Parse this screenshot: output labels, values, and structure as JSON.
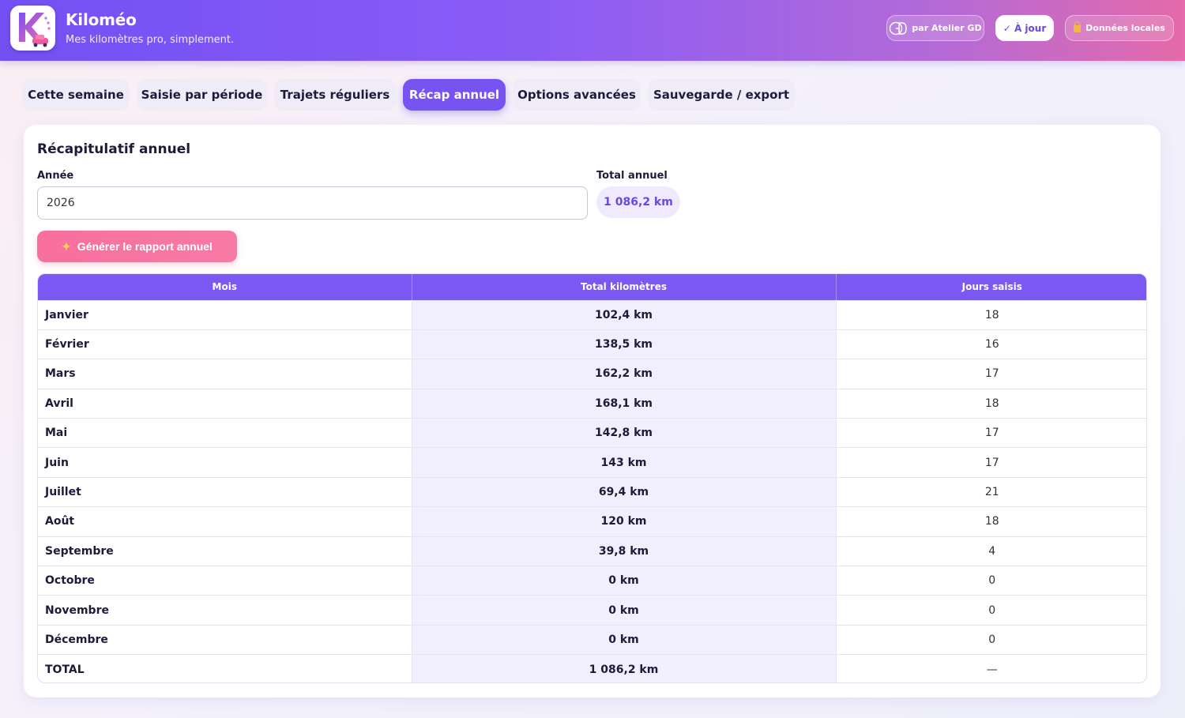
{
  "app": {
    "title": "Kiloméo",
    "subtitle": "Mes kilomètres pro, simplement."
  },
  "header": {
    "badges": {
      "atelier": "par Atelier GD",
      "status": "✓ À jour",
      "local": "Données locales"
    }
  },
  "tabs": [
    {
      "label": "Cette semaine",
      "active": false
    },
    {
      "label": "Saisie par période",
      "active": false
    },
    {
      "label": "Trajets réguliers",
      "active": false
    },
    {
      "label": "Récap annuel",
      "active": true
    },
    {
      "label": "Options avancées",
      "active": false
    },
    {
      "label": "Sauvegarde / export",
      "active": false
    }
  ],
  "recap": {
    "title": "Récapitulatif annuel",
    "year_label": "Année",
    "year_value": "2026",
    "total_label": "Total annuel",
    "total_value": "1 086,2 km",
    "generate_label": "Générer le rapport annuel",
    "table": {
      "headers": [
        "Mois",
        "Total kilomètres",
        "Jours saisis"
      ],
      "rows": [
        {
          "month": "Janvier",
          "km": "102,4 km",
          "days": "18"
        },
        {
          "month": "Février",
          "km": "138,5 km",
          "days": "16"
        },
        {
          "month": "Mars",
          "km": "162,2 km",
          "days": "17"
        },
        {
          "month": "Avril",
          "km": "168,1 km",
          "days": "18"
        },
        {
          "month": "Mai",
          "km": "142,8 km",
          "days": "17"
        },
        {
          "month": "Juin",
          "km": "143 km",
          "days": "17"
        },
        {
          "month": "Juillet",
          "km": "69,4 km",
          "days": "21"
        },
        {
          "month": "Août",
          "km": "120 km",
          "days": "18"
        },
        {
          "month": "Septembre",
          "km": "39,8 km",
          "days": "4"
        },
        {
          "month": "Octobre",
          "km": "0 km",
          "days": "0"
        },
        {
          "month": "Novembre",
          "km": "0 km",
          "days": "0"
        },
        {
          "month": "Décembre",
          "km": "0 km",
          "days": "0"
        },
        {
          "month": "TOTAL",
          "km": "1 086,2 km",
          "days": "—"
        }
      ]
    }
  },
  "colors": {
    "accent": "#7753f1",
    "header_start": "#7350f3",
    "header_end": "#e46aa9",
    "button_pink": "#f76f9e"
  },
  "icons": {
    "logo": "kilomeo-logo-icon",
    "atelier": "atelier-gd-logo-icon",
    "lock": "lock-icon",
    "sparkle": "sparkle-icon"
  }
}
